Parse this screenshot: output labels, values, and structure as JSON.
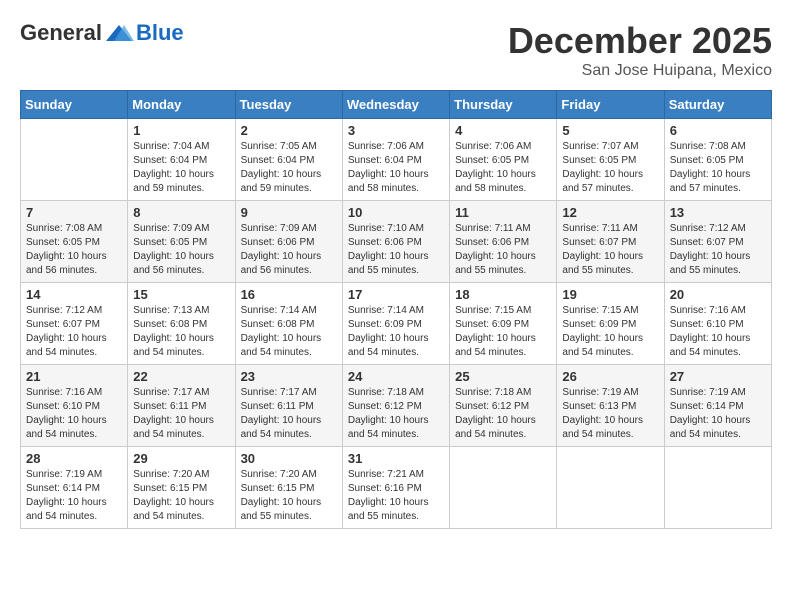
{
  "header": {
    "logo_general": "General",
    "logo_blue": "Blue",
    "month_title": "December 2025",
    "location": "San Jose Huipana, Mexico"
  },
  "weekdays": [
    "Sunday",
    "Monday",
    "Tuesday",
    "Wednesday",
    "Thursday",
    "Friday",
    "Saturday"
  ],
  "weeks": [
    [
      {
        "day": "",
        "info": ""
      },
      {
        "day": "1",
        "info": "Sunrise: 7:04 AM\nSunset: 6:04 PM\nDaylight: 10 hours\nand 59 minutes."
      },
      {
        "day": "2",
        "info": "Sunrise: 7:05 AM\nSunset: 6:04 PM\nDaylight: 10 hours\nand 59 minutes."
      },
      {
        "day": "3",
        "info": "Sunrise: 7:06 AM\nSunset: 6:04 PM\nDaylight: 10 hours\nand 58 minutes."
      },
      {
        "day": "4",
        "info": "Sunrise: 7:06 AM\nSunset: 6:05 PM\nDaylight: 10 hours\nand 58 minutes."
      },
      {
        "day": "5",
        "info": "Sunrise: 7:07 AM\nSunset: 6:05 PM\nDaylight: 10 hours\nand 57 minutes."
      },
      {
        "day": "6",
        "info": "Sunrise: 7:08 AM\nSunset: 6:05 PM\nDaylight: 10 hours\nand 57 minutes."
      }
    ],
    [
      {
        "day": "7",
        "info": "Sunrise: 7:08 AM\nSunset: 6:05 PM\nDaylight: 10 hours\nand 56 minutes."
      },
      {
        "day": "8",
        "info": "Sunrise: 7:09 AM\nSunset: 6:05 PM\nDaylight: 10 hours\nand 56 minutes."
      },
      {
        "day": "9",
        "info": "Sunrise: 7:09 AM\nSunset: 6:06 PM\nDaylight: 10 hours\nand 56 minutes."
      },
      {
        "day": "10",
        "info": "Sunrise: 7:10 AM\nSunset: 6:06 PM\nDaylight: 10 hours\nand 55 minutes."
      },
      {
        "day": "11",
        "info": "Sunrise: 7:11 AM\nSunset: 6:06 PM\nDaylight: 10 hours\nand 55 minutes."
      },
      {
        "day": "12",
        "info": "Sunrise: 7:11 AM\nSunset: 6:07 PM\nDaylight: 10 hours\nand 55 minutes."
      },
      {
        "day": "13",
        "info": "Sunrise: 7:12 AM\nSunset: 6:07 PM\nDaylight: 10 hours\nand 55 minutes."
      }
    ],
    [
      {
        "day": "14",
        "info": "Sunrise: 7:12 AM\nSunset: 6:07 PM\nDaylight: 10 hours\nand 54 minutes."
      },
      {
        "day": "15",
        "info": "Sunrise: 7:13 AM\nSunset: 6:08 PM\nDaylight: 10 hours\nand 54 minutes."
      },
      {
        "day": "16",
        "info": "Sunrise: 7:14 AM\nSunset: 6:08 PM\nDaylight: 10 hours\nand 54 minutes."
      },
      {
        "day": "17",
        "info": "Sunrise: 7:14 AM\nSunset: 6:09 PM\nDaylight: 10 hours\nand 54 minutes."
      },
      {
        "day": "18",
        "info": "Sunrise: 7:15 AM\nSunset: 6:09 PM\nDaylight: 10 hours\nand 54 minutes."
      },
      {
        "day": "19",
        "info": "Sunrise: 7:15 AM\nSunset: 6:09 PM\nDaylight: 10 hours\nand 54 minutes."
      },
      {
        "day": "20",
        "info": "Sunrise: 7:16 AM\nSunset: 6:10 PM\nDaylight: 10 hours\nand 54 minutes."
      }
    ],
    [
      {
        "day": "21",
        "info": "Sunrise: 7:16 AM\nSunset: 6:10 PM\nDaylight: 10 hours\nand 54 minutes."
      },
      {
        "day": "22",
        "info": "Sunrise: 7:17 AM\nSunset: 6:11 PM\nDaylight: 10 hours\nand 54 minutes."
      },
      {
        "day": "23",
        "info": "Sunrise: 7:17 AM\nSunset: 6:11 PM\nDaylight: 10 hours\nand 54 minutes."
      },
      {
        "day": "24",
        "info": "Sunrise: 7:18 AM\nSunset: 6:12 PM\nDaylight: 10 hours\nand 54 minutes."
      },
      {
        "day": "25",
        "info": "Sunrise: 7:18 AM\nSunset: 6:12 PM\nDaylight: 10 hours\nand 54 minutes."
      },
      {
        "day": "26",
        "info": "Sunrise: 7:19 AM\nSunset: 6:13 PM\nDaylight: 10 hours\nand 54 minutes."
      },
      {
        "day": "27",
        "info": "Sunrise: 7:19 AM\nSunset: 6:14 PM\nDaylight: 10 hours\nand 54 minutes."
      }
    ],
    [
      {
        "day": "28",
        "info": "Sunrise: 7:19 AM\nSunset: 6:14 PM\nDaylight: 10 hours\nand 54 minutes."
      },
      {
        "day": "29",
        "info": "Sunrise: 7:20 AM\nSunset: 6:15 PM\nDaylight: 10 hours\nand 54 minutes."
      },
      {
        "day": "30",
        "info": "Sunrise: 7:20 AM\nSunset: 6:15 PM\nDaylight: 10 hours\nand 55 minutes."
      },
      {
        "day": "31",
        "info": "Sunrise: 7:21 AM\nSunset: 6:16 PM\nDaylight: 10 hours\nand 55 minutes."
      },
      {
        "day": "",
        "info": ""
      },
      {
        "day": "",
        "info": ""
      },
      {
        "day": "",
        "info": ""
      }
    ]
  ]
}
